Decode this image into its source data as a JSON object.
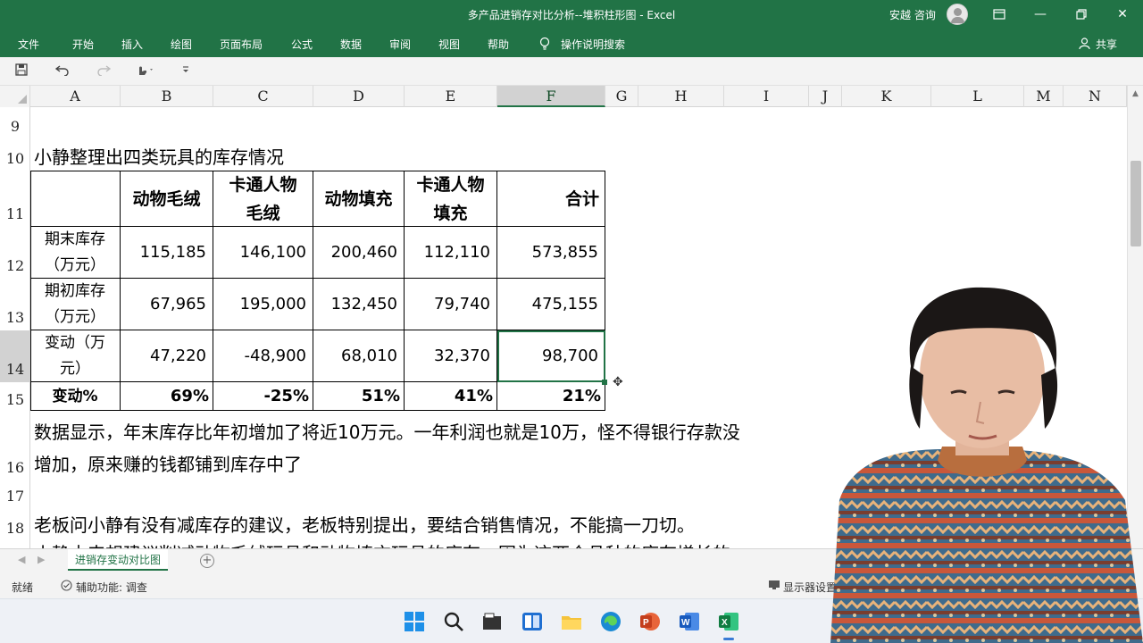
{
  "window": {
    "title": "多产品进销存对比分析--堆积柱形图  -  Excel",
    "user": "安越 咨询",
    "controls": [
      "restore-ribbon",
      "minimize",
      "maximize",
      "close"
    ]
  },
  "ribbon": {
    "tabs": [
      "文件",
      "开始",
      "插入",
      "绘图",
      "页面布局",
      "公式",
      "数据",
      "审阅",
      "视图",
      "帮助"
    ],
    "search_label": "操作说明搜索",
    "share_label": "共享"
  },
  "columns": [
    "A",
    "B",
    "C",
    "D",
    "E",
    "F",
    "G",
    "H",
    "I",
    "J",
    "K",
    "L",
    "M",
    "N"
  ],
  "selected_column": "F",
  "rows": [
    "9",
    "10",
    "11",
    "12",
    "13",
    "14",
    "15",
    "16",
    "17",
    "18"
  ],
  "selected_row": "14",
  "caption": "小静整理出四类玩具的库存情况",
  "table": {
    "headers": [
      "",
      "动物毛绒",
      "卡通人物毛绒",
      "动物填充",
      "卡通人物填充",
      "合计"
    ],
    "rows": [
      {
        "label": "期末库存（万元）",
        "values": [
          "115,185",
          "146,100",
          "200,460",
          "112,110",
          "573,855"
        ]
      },
      {
        "label": "期初库存（万元）",
        "values": [
          "67,965",
          "195,000",
          "132,450",
          "79,740",
          "475,155"
        ]
      },
      {
        "label": "变动（万元）",
        "values": [
          "47,220",
          "-48,900",
          "68,010",
          "32,370",
          "98,700"
        ]
      },
      {
        "label": "变动%",
        "values": [
          "69%",
          "-25%",
          "51%",
          "41%",
          "21%"
        ]
      }
    ]
  },
  "paragraphs": {
    "p16_line1": "数据显示，年末库存比年初增加了将近10万元。一年利润也就是10万，怪不得银行存款没",
    "p16_line2": "增加，原来赚的钱都铺到库存中了",
    "p18": "老板问小静有没有减库存的建议，老板特别提出，要结合销售情况，不能搞一刀切。",
    "p19_partial": "小静本来想建议削减动物毛绒玩具和动物填充玩具的库存，因为这两个品种的库存增长的"
  },
  "sheet_tab": "进销存变动对比图",
  "status": {
    "ready": "就绪",
    "accessibility": "辅助功能: 调查",
    "display_settings": "显示器设置"
  },
  "taskbar_apps": [
    "windows-start",
    "search",
    "file-manager",
    "snap-layout",
    "file-explorer",
    "edge",
    "powerpoint",
    "word",
    "excel"
  ],
  "colors": {
    "excel_green": "#217346",
    "ribbon_text": "#ffffff",
    "grid_bg": "#ffffff",
    "header_bg": "#f3f3f3"
  }
}
